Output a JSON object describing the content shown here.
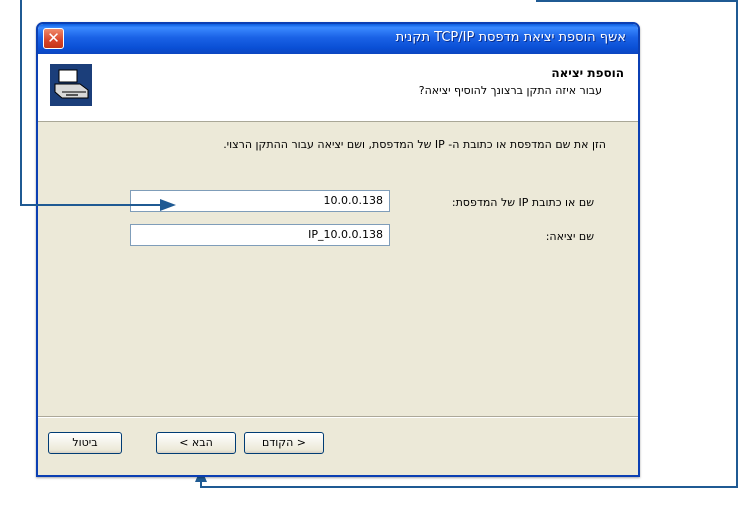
{
  "window": {
    "title": "אשף הוספת יציאת מדפסת TCP/IP תקנית",
    "close_glyph": "✕"
  },
  "header": {
    "title": "הוספת יציאה",
    "subtitle": "עבור איזה התקן ברצונך להוסיף יציאה?"
  },
  "body": {
    "instruction": "הזן את שם המדפסת או כתובת ה- IP של המדפסת, ושם יציאה עבור ההתקן הרצוי."
  },
  "fields": {
    "printer_name_label": "שם או כתובת IP של המדפסת:",
    "printer_name_value": "10.0.0.138",
    "port_name_label": "שם יציאה:",
    "port_name_value": "IP_10.0.0.138"
  },
  "buttons": {
    "back": "< הקודם",
    "next": "הבא >",
    "cancel": "ביטול"
  },
  "colors": {
    "callout_line": "#1f5a93",
    "titlebar": "#0a4fd5"
  },
  "icons": {
    "header_icon": "printer-icon",
    "close": "close-icon"
  }
}
